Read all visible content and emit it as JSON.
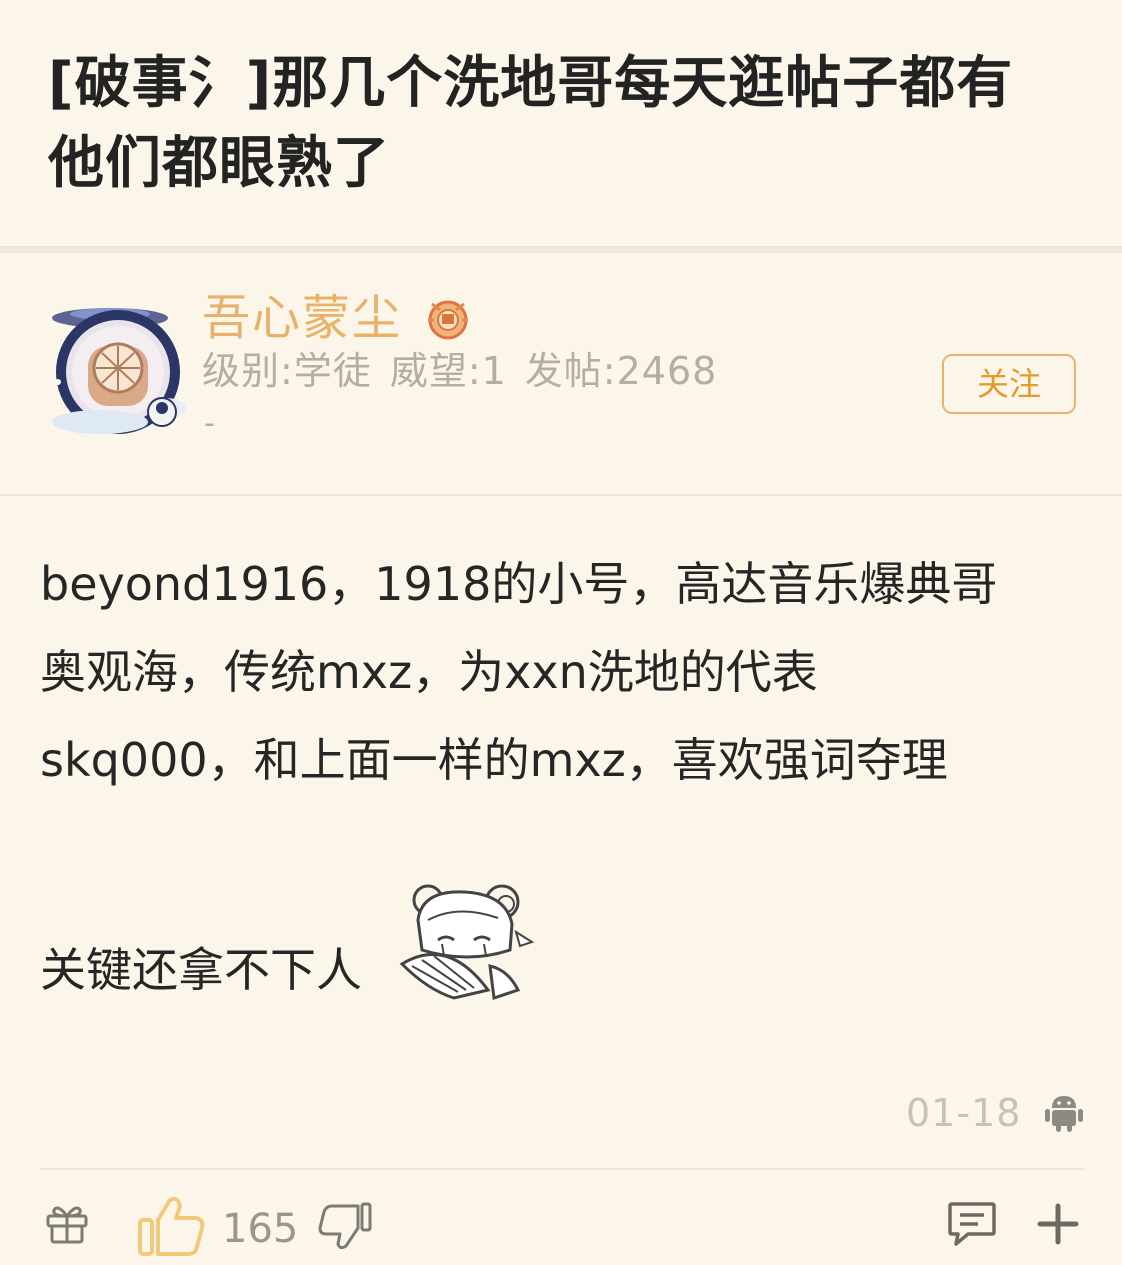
{
  "post": {
    "title_line1": "[破事氵]那几个洗地哥每天逛帖子都有",
    "title_line2": "他们都眼熟了"
  },
  "author": {
    "name": "吾心蒙尘",
    "level": "级别:学徒",
    "prestige": "威望:1",
    "posts": "发帖:2468",
    "extra": "-",
    "follow_label": "关注",
    "avatar_icon": "astronaut-porthole-avatar",
    "badge_icon": "honor-medal-icon"
  },
  "content": {
    "lines": [
      "beyond1916，1918的小号，高达音乐爆典哥",
      "奥观海，传统mxz，为xxn洗地的代表",
      "skq000，和上面一样的mxz，喜欢强词夺理"
    ],
    "last_line": "关键还拿不下人",
    "sticker": "anime-girl-fan-sticker"
  },
  "footer": {
    "date": "01-18",
    "device_icon": "android-icon",
    "like_count": "165"
  },
  "colors": {
    "background": "#fbf6e9",
    "username": "#e8b26a",
    "accent": "#e59a2c",
    "like": "#f0c97a",
    "meta": "#b4aea1"
  }
}
